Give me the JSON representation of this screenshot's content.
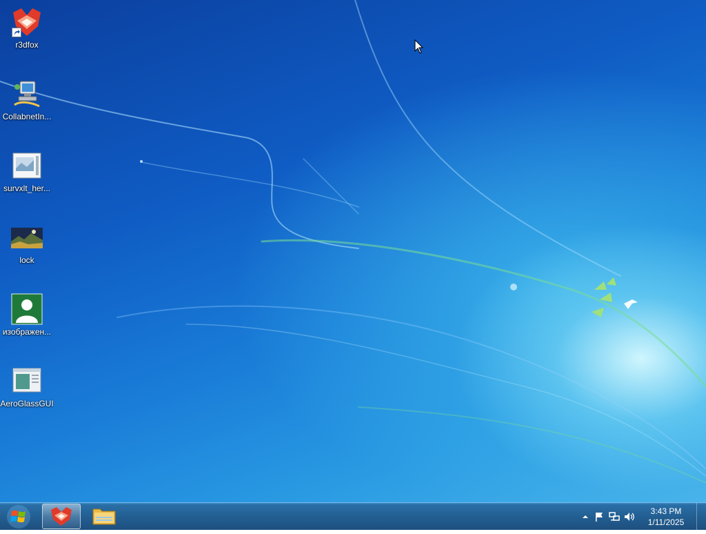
{
  "desktop": {
    "icons": [
      {
        "label": "r3dfox",
        "icon": "r3dfox-icon"
      },
      {
        "label": "CollabnetIn...",
        "icon": "computer-network-icon"
      },
      {
        "label": "survxlt_her...",
        "icon": "document-image-icon"
      },
      {
        "label": "lock",
        "icon": "landscape-image-icon"
      },
      {
        "label": "изображен...",
        "icon": "user-avatar-icon"
      },
      {
        "label": "AeroGlassGUI",
        "icon": "app-window-icon"
      }
    ]
  },
  "taskbar": {
    "start": {
      "icon": "windows-logo-icon"
    },
    "pinned": [
      {
        "name": "r3dfox",
        "icon": "r3dfox-icon",
        "active": true
      },
      {
        "name": "Windows Explorer",
        "icon": "folder-icon",
        "active": false
      }
    ],
    "tray": {
      "icons": [
        "show-hidden-icons-arrow",
        "action-center-flag-icon",
        "network-icon",
        "volume-icon"
      ],
      "time": "3:43 PM",
      "date": "1/11/2025"
    }
  },
  "colors": {
    "wallpaper_dark": "#0b3f9e",
    "wallpaper_light": "#49b4ea",
    "taskbar": "#235f92",
    "icon_text": "#ffffff"
  }
}
